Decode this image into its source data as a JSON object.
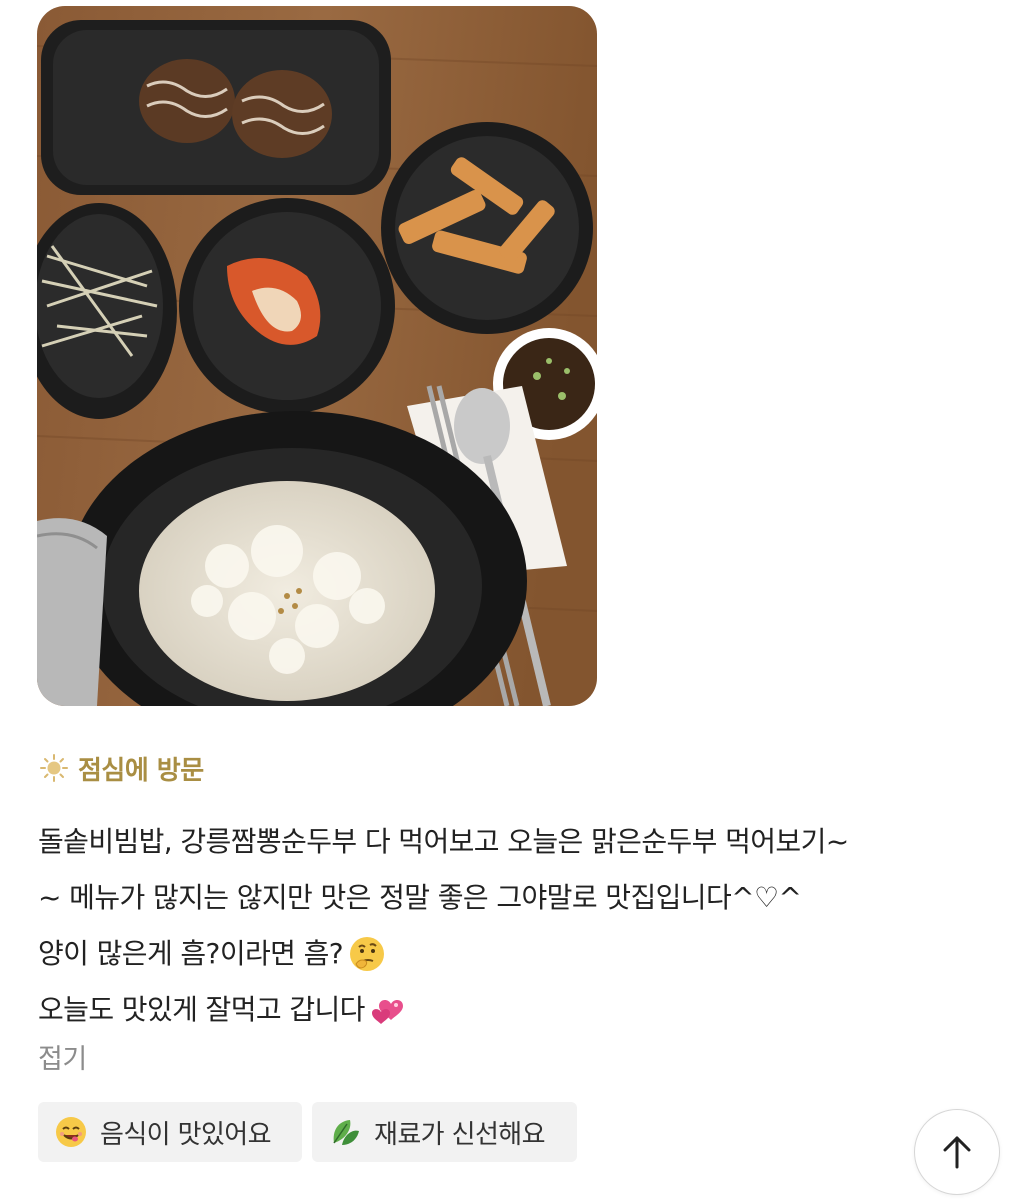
{
  "photo": {
    "alt_icon": "food-photo"
  },
  "visit": {
    "icon": "sun-icon",
    "label": "점심에 방문"
  },
  "review": {
    "lines": [
      "돌솥비빔밥, 강릉짬뽕순두부 다 먹어보고 오늘은 맑은순두부 먹어보기~",
      "~ 메뉴가 많지는 않지만 맛은 정말 좋은 그야말로 맛집입니다^♡^",
      "양이 많은게 흠?이라면 흠?",
      "오늘도 맛있게 잘먹고 갑니다"
    ],
    "emojis": [
      "thinking-face-icon",
      "two-hearts-icon"
    ]
  },
  "fold_label": "접기",
  "tags": [
    {
      "icon": "yum-face-icon",
      "label": "음식이 맛있어요"
    },
    {
      "icon": "leaf-icon",
      "label": "재료가 신선해요"
    }
  ],
  "scroll_top": {
    "icon": "arrow-up-icon"
  }
}
